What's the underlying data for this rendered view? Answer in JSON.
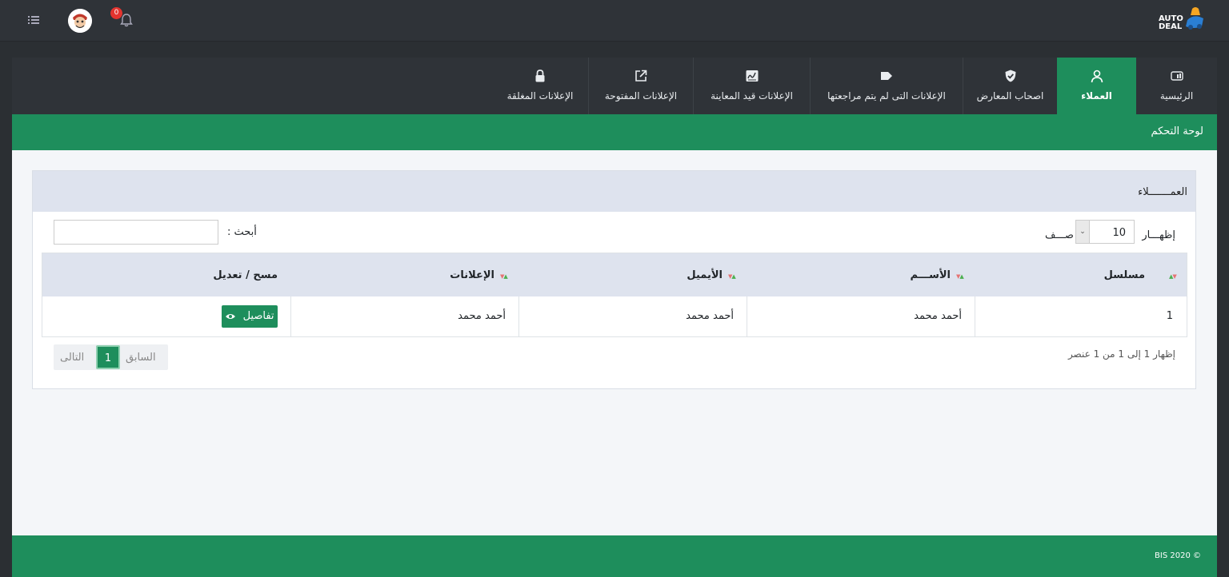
{
  "header": {
    "notification_count": "0",
    "logo_line1": "AUTO",
    "logo_line2": "DEAL"
  },
  "tabs": [
    {
      "label": "الرئيسية",
      "icon": "home-dashboard-icon"
    },
    {
      "label": "العملاء",
      "icon": "user-icon",
      "active": true
    },
    {
      "label": "اصحاب المعارض",
      "icon": "shield-check-icon"
    },
    {
      "label": "الإعلانات التى لم يتم مراجعتها",
      "icon": "tag-icon"
    },
    {
      "label": "الإعلانات قيد المعاينة",
      "icon": "signature-icon"
    },
    {
      "label": "الإعلانات المفتوحة",
      "icon": "external-link-icon"
    },
    {
      "label": "الإعلانات المغلقة",
      "icon": "lock-icon"
    }
  ],
  "page": {
    "title": "لوحة التحكم"
  },
  "card": {
    "title": "العمـــــــلاء",
    "show_label": "إظهـــار",
    "rows_value": "10",
    "rows_label": "صـــف",
    "search_label": "أبحث :",
    "search_value": ""
  },
  "table": {
    "columns": [
      "مسلسل",
      "الأســـم",
      "الأيميل",
      "الإعلانات",
      "مسح / تعديل"
    ],
    "rows": [
      {
        "serial": "1",
        "name": "أحمد محمد",
        "email": "أحمد محمد",
        "ads": "أحمد محمد",
        "action": "تفاصيل"
      }
    ]
  },
  "pagination": {
    "info": "إظهار 1 إلى 1 من 1 عنصر",
    "prev": "السابق",
    "current": "1",
    "next": "التالى"
  },
  "footer": {
    "copyright": "BIS 2020 ©"
  },
  "colors": {
    "accent": "#1e8e5c",
    "dark": "#2f3338",
    "badge": "#e3342f"
  }
}
